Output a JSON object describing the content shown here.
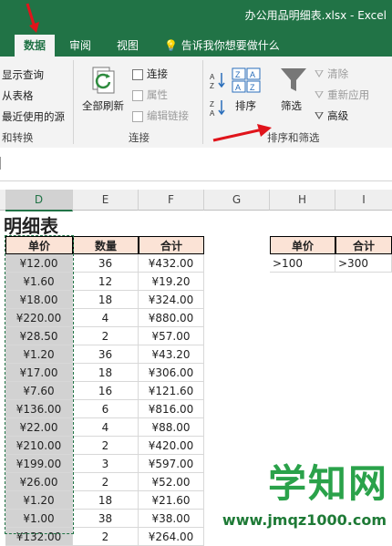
{
  "window": {
    "title": "办公用品明细表.xlsx - Excel"
  },
  "tabs": [
    {
      "label": "数据",
      "active": true
    },
    {
      "label": "审阅"
    },
    {
      "label": "视图"
    }
  ],
  "tellme": "告诉我你想要做什么",
  "ribbon": {
    "get_transform": {
      "items": [
        "显示查询",
        "从表格",
        "最近使用的源"
      ],
      "group": "和转换"
    },
    "connections": {
      "refresh_all": "全部刷新",
      "items": [
        "连接",
        "属性",
        "编辑链接"
      ],
      "group": "连接"
    },
    "sort_filter": {
      "sort": "排序",
      "filter": "筛选",
      "clear": "清除",
      "reapply": "重新应用",
      "advanced": "高级",
      "group": "排序和筛选"
    }
  },
  "columns": [
    "D",
    "E",
    "F",
    "G",
    "H",
    "I"
  ],
  "sheet": {
    "title": "明细表",
    "headers": [
      "单价",
      "数量",
      "合计"
    ],
    "rows": [
      [
        "¥12.00",
        "36",
        "¥432.00"
      ],
      [
        "¥1.60",
        "12",
        "¥19.20"
      ],
      [
        "¥18.00",
        "18",
        "¥324.00"
      ],
      [
        "¥220.00",
        "4",
        "¥880.00"
      ],
      [
        "¥28.50",
        "2",
        "¥57.00"
      ],
      [
        "¥1.20",
        "36",
        "¥43.20"
      ],
      [
        "¥17.00",
        "18",
        "¥306.00"
      ],
      [
        "¥7.60",
        "16",
        "¥121.60"
      ],
      [
        "¥136.00",
        "6",
        "¥816.00"
      ],
      [
        "¥22.00",
        "4",
        "¥88.00"
      ],
      [
        "¥210.00",
        "2",
        "¥420.00"
      ],
      [
        "¥199.00",
        "3",
        "¥597.00"
      ],
      [
        "¥26.00",
        "2",
        "¥52.00"
      ],
      [
        "¥1.20",
        "18",
        "¥21.60"
      ],
      [
        "¥1.00",
        "38",
        "¥38.00"
      ],
      [
        "¥132.00",
        "2",
        "¥264.00"
      ]
    ],
    "criteria_headers": [
      "单价",
      "合计"
    ],
    "criteria_values": [
      ">100",
      ">300"
    ]
  },
  "watermark": {
    "main": "学知网",
    "url": "www.jmqz1000.com"
  },
  "colors": {
    "excel_green": "#217346",
    "header_fill": "#fbe3d6",
    "selected_fill": "#d2d2d2",
    "arrow": "#e0141b"
  }
}
